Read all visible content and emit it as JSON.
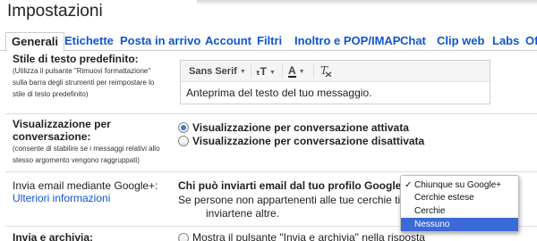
{
  "page": {
    "title": "Impostazioni"
  },
  "tabs": [
    {
      "label": "Generali",
      "active": true
    },
    {
      "label": "Etichette"
    },
    {
      "label": "Posta in arrivo"
    },
    {
      "label": "Account"
    },
    {
      "label": "Filtri"
    },
    {
      "label": "Inoltro e POP/IMAP"
    },
    {
      "label": "Chat"
    },
    {
      "label": "Clip web"
    },
    {
      "label": "Labs"
    },
    {
      "label": "Of"
    }
  ],
  "default_text_style": {
    "label": "Stile di testo predefinito:",
    "note_lines": [
      "(Utilizza il pulsante \"Rimuovi formattazione\"",
      "sulla barra degli strumenti per reimpostare lo",
      "stile di testo predefinito)"
    ],
    "toolbar": {
      "font": "Sans Serif",
      "size_icon": "text-size-icon",
      "color_icon": "text-color-icon",
      "clear_icon": "remove-formatting-icon"
    },
    "preview_text": "Anteprima del testo del tuo messaggio."
  },
  "conversation_view": {
    "label_lines": [
      "Visualizzazione per",
      "conversazione:"
    ],
    "note_lines": [
      "(consente di stabilire se i messaggi relativi allo",
      "stesso argomento vengono raggruppati)"
    ],
    "options": [
      {
        "label": "Visualizzazione per conversazione attivata",
        "checked": true
      },
      {
        "label": "Visualizzazione per conversazione disattivata",
        "checked": false
      }
    ]
  },
  "google_plus": {
    "label": "Invia email mediante Google+:",
    "link": "Ulteriori informazioni",
    "question": "Chi può inviarti email dal tuo profilo Google+",
    "desc_line1": "Se persone non appartenenti alle tue cerchie ti i",
    "desc_line2": "inviartene altre.",
    "menu": {
      "items": [
        "Chiunque su Google+",
        "Cerchie estese",
        "Cerchie",
        "Nessuno"
      ],
      "checked_index": 0,
      "highlighted_index": 3
    }
  },
  "send_archive": {
    "label": "Invia e archivia:",
    "option": "Mostra il pulsante \"Invia e archivia\" nella risposta"
  }
}
